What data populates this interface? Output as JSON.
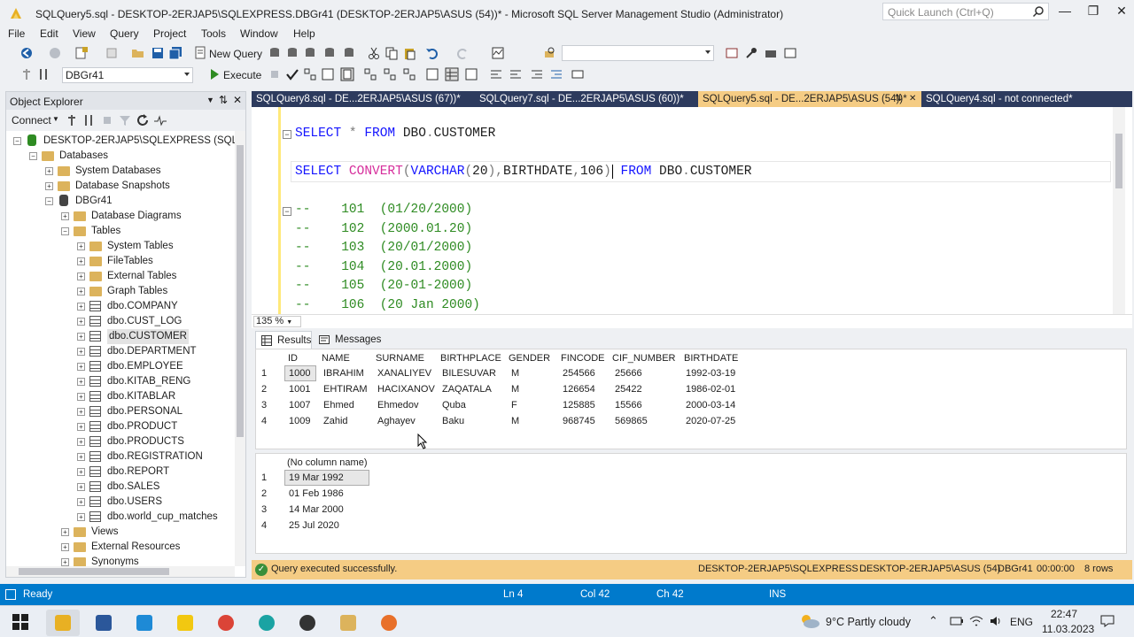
{
  "window": {
    "title": "SQLQuery5.sql - DESKTOP-2ERJAP5\\SQLEXPRESS.DBGr41 (DESKTOP-2ERJAP5\\ASUS (54))* - Microsoft SQL Server Management Studio (Administrator)",
    "quick_launch_placeholder": "Quick Launch (Ctrl+Q)"
  },
  "menu": [
    "File",
    "Edit",
    "View",
    "Query",
    "Project",
    "Tools",
    "Window",
    "Help"
  ],
  "toolbar": {
    "new_query": "New Query",
    "database": "DBGr41",
    "execute": "Execute"
  },
  "object_explorer": {
    "title": "Object Explorer",
    "connect": "Connect",
    "server": "DESKTOP-2ERJAP5\\SQLEXPRESS (SQL Serve",
    "databases": "Databases",
    "system_databases": "System Databases",
    "snapshots": "Database Snapshots",
    "db": "DBGr41",
    "diagrams": "Database Diagrams",
    "tables": "Tables",
    "system_tables": "System Tables",
    "file_tables": "FileTables",
    "external_tables": "External Tables",
    "graph_tables": "Graph Tables",
    "table_list": [
      "dbo.COMPANY",
      "dbo.CUST_LOG",
      "dbo.CUSTOMER",
      "dbo.DEPARTMENT",
      "dbo.EMPLOYEE",
      "dbo.KITAB_RENG",
      "dbo.KITABLAR",
      "dbo.PERSONAL",
      "dbo.PRODUCT",
      "dbo.PRODUCTS",
      "dbo.REGISTRATION",
      "dbo.REPORT",
      "dbo.SALES",
      "dbo.USERS",
      "dbo.world_cup_matches"
    ],
    "views": "Views",
    "external_resources": "External Resources",
    "synonyms": "Synonyms"
  },
  "tabs": [
    {
      "label": "SQLQuery8.sql - DE...2ERJAP5\\ASUS (67))*"
    },
    {
      "label": "SQLQuery7.sql - DE...2ERJAP5\\ASUS (60))*"
    },
    {
      "label": "SQLQuery5.sql - DE...2ERJAP5\\ASUS (54))*"
    },
    {
      "label": "SQLQuery4.sql - not connected*"
    }
  ],
  "editor": {
    "zoom": "135 %",
    "comments": [
      {
        "code": "101",
        "example": "(01/20/2000)"
      },
      {
        "code": "102",
        "example": "(2000.01.20)"
      },
      {
        "code": "103",
        "example": "(20/01/2000)"
      },
      {
        "code": "104",
        "example": "(20.01.2000)"
      },
      {
        "code": "105",
        "example": "(20-01-2000)"
      },
      {
        "code": "106",
        "example": "(20 Jan 2000)"
      }
    ]
  },
  "results": {
    "tab_results": "Results",
    "tab_messages": "Messages",
    "grid1": {
      "columns": [
        "ID",
        "NAME",
        "SURNAME",
        "BIRTHPLACE",
        "GENDER",
        "FINCODE",
        "CIF_NUMBER",
        "BIRTHDATE"
      ],
      "rows": [
        [
          "1000",
          "IBRAHIM",
          "XANALIYEV",
          "BILESUVAR",
          "M",
          "254566",
          "25666",
          "1992-03-19"
        ],
        [
          "1001",
          "EHTIRAM",
          "HACIXANOV",
          "ZAQATALA",
          "M",
          "126654",
          "25422",
          "1986-02-01"
        ],
        [
          "1007",
          "Ehmed",
          "Ehmedov",
          "Quba",
          "F",
          "125885",
          "15566",
          "2000-03-14"
        ],
        [
          "1009",
          "Zahid",
          "Aghayev",
          "Baku",
          "M",
          "968745",
          "569865",
          "2020-07-25"
        ]
      ]
    },
    "grid2": {
      "column": "(No column name)",
      "rows": [
        "19 Mar 1992",
        "01 Feb 1986",
        "14 Mar 2000",
        "25 Jul 2020"
      ]
    }
  },
  "query_status": {
    "message": "Query executed successfully.",
    "server": "DESKTOP-2ERJAP5\\SQLEXPRESS ...",
    "user": "DESKTOP-2ERJAP5\\ASUS (54)",
    "db": "DBGr41",
    "time": "00:00:00",
    "rows": "8 rows"
  },
  "statusbar": {
    "ready": "Ready",
    "ln": "Ln 4",
    "col": "Col 42",
    "ch": "Ch 42",
    "ins": "INS"
  },
  "taskbar": {
    "weather": "9°C  Partly cloudy",
    "lang": "ENG",
    "time": "22:47",
    "date": "11.03.2023"
  },
  "colors": {
    "accent": "#007acc",
    "tab_active": "#f5cc84",
    "tabstrip": "#2d3b5e",
    "keyword": "#1515ff",
    "function": "#d62e9c",
    "comment": "#2e8b22"
  }
}
